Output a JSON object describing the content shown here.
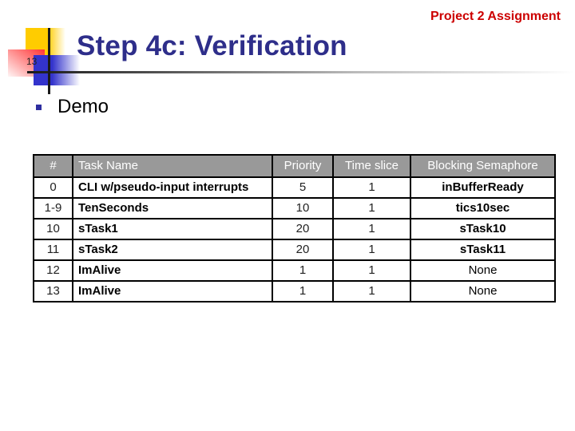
{
  "header_tag": "Project 2 Assignment",
  "slide_number": "13",
  "title": "Step 4c: Verification",
  "bullets": [
    {
      "text": "Demo"
    }
  ],
  "colors": {
    "title": "#2e2e8a",
    "header_tag": "#cc0000",
    "table_header_bg": "#999999",
    "bullet": "#2e2ea0"
  },
  "table": {
    "headers": [
      "#",
      "Task Name",
      "Priority",
      "Time slice",
      "Blocking Semaphore"
    ],
    "rows": [
      {
        "num": "0",
        "name": "CLI w/pseudo-input interrupts",
        "priority": "5",
        "time_slice": "1",
        "semaphore": "inBufferReady",
        "semaphore_bold": true
      },
      {
        "num": "1-9",
        "name": "TenSeconds",
        "priority": "10",
        "time_slice": "1",
        "semaphore": "tics10sec",
        "semaphore_bold": true
      },
      {
        "num": "10",
        "name": "sTask1",
        "priority": "20",
        "time_slice": "1",
        "semaphore": "sTask10",
        "semaphore_bold": true
      },
      {
        "num": "11",
        "name": "sTask2",
        "priority": "20",
        "time_slice": "1",
        "semaphore": "sTask11",
        "semaphore_bold": true
      },
      {
        "num": "12",
        "name": "ImAlive",
        "priority": "1",
        "time_slice": "1",
        "semaphore": "None",
        "semaphore_bold": false
      },
      {
        "num": "13",
        "name": "ImAlive",
        "priority": "1",
        "time_slice": "1",
        "semaphore": "None",
        "semaphore_bold": false
      }
    ]
  }
}
